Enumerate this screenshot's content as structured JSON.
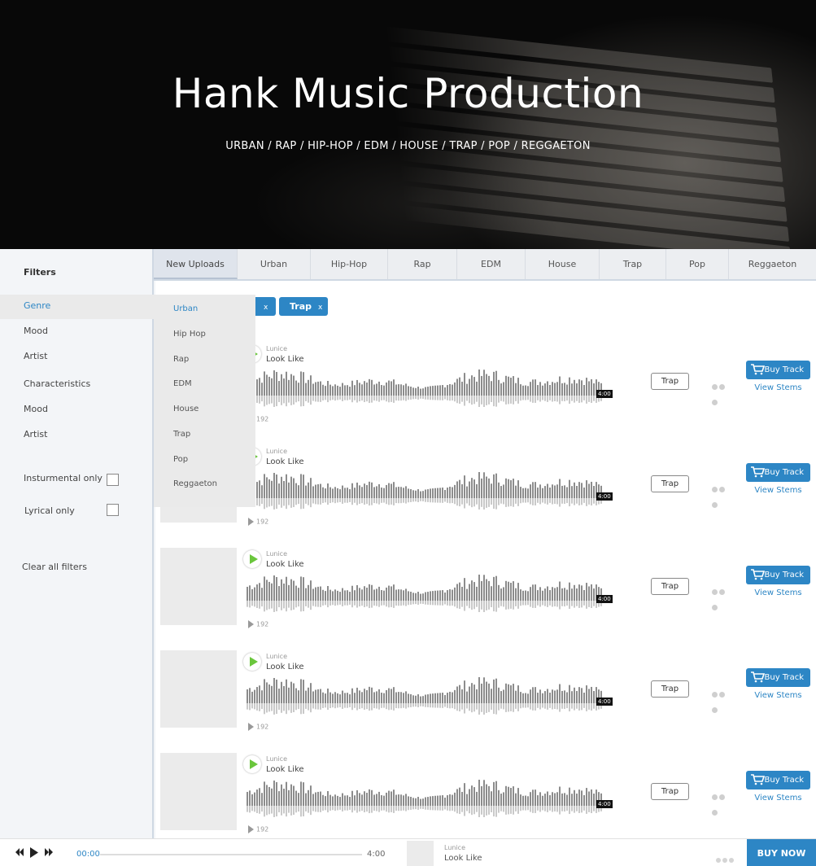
{
  "hero": {
    "title": "Hank Music Production",
    "genres": "URBAN / RAP / HIP-HOP / EDM / HOUSE / TRAP / POP / REGGAETON"
  },
  "sidebar": {
    "title": "Filters",
    "genre": "Genre",
    "mood": "Mood",
    "artist": "Artist",
    "characteristics": "Characteristics",
    "mood2": "Mood",
    "artist2": "Artist",
    "instrumental_label": "Insturmental only",
    "lyrical_label": "Lyrical only",
    "clear": "Clear all filters"
  },
  "tabs": [
    "New Uploads",
    "Urban",
    "Hip-Hop",
    "Rap",
    "EDM",
    "House",
    "Trap",
    "Pop",
    "Reggaeton"
  ],
  "chips": [
    {
      "label": "",
      "remove": "x"
    },
    {
      "label": "Trap",
      "remove": "x"
    }
  ],
  "dropdown": [
    "Urban",
    "Hip Hop",
    "Rap",
    "EDM",
    "House",
    "Trap",
    "Pop",
    "Reggaeton"
  ],
  "tracks": [
    {
      "artist": "Lunice",
      "title": "Look Like",
      "duration": "4:00",
      "plays": "192",
      "tag": "Trap",
      "buy": "Buy Track",
      "stems": "View Stems"
    },
    {
      "artist": "Lunice",
      "title": "Look Like",
      "duration": "4:00",
      "plays": "192",
      "tag": "Trap",
      "buy": "Buy Track",
      "stems": "View Stems"
    },
    {
      "artist": "Lunice",
      "title": "Look Like",
      "duration": "4:00",
      "plays": "192",
      "tag": "Trap",
      "buy": "Buy Track",
      "stems": "View Stems"
    },
    {
      "artist": "Lunice",
      "title": "Look Like",
      "duration": "4:00",
      "plays": "192",
      "tag": "Trap",
      "buy": "Buy Track",
      "stems": "View Stems"
    },
    {
      "artist": "Lunice",
      "title": "Look Like",
      "duration": "4:00",
      "plays": "192",
      "tag": "Trap",
      "buy": "Buy Track",
      "stems": "View Stems"
    }
  ],
  "player": {
    "current": "00:00",
    "total": "4:00",
    "progress": 0,
    "artist": "Lunice",
    "title": "Look Like",
    "buy_now": "BUY NOW"
  },
  "colors": {
    "accent": "#2d86c5",
    "play_green": "#6ac63c"
  }
}
